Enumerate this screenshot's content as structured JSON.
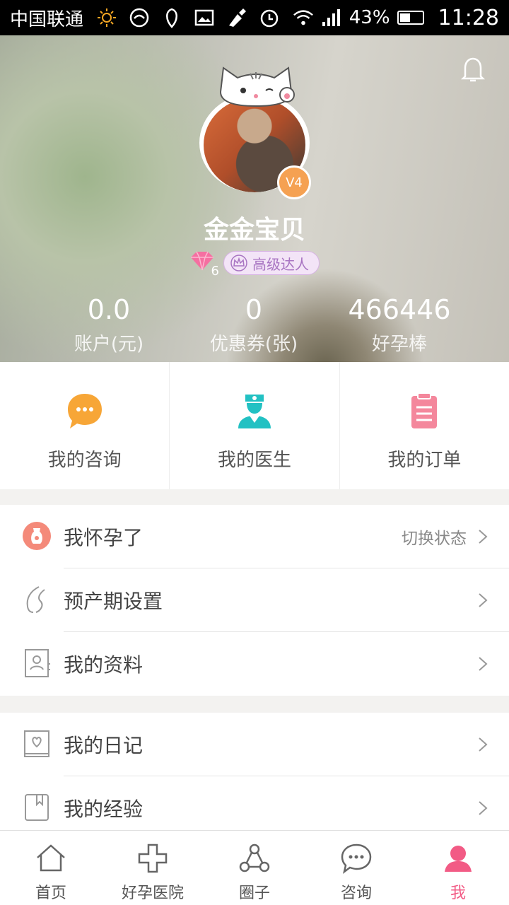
{
  "status_bar": {
    "carrier": "中国联通",
    "battery": "43%",
    "time": "11:28"
  },
  "profile": {
    "name": "金金宝贝",
    "level_badge": "V4",
    "gem_count": "6",
    "rank_label": "高级达人"
  },
  "stats": [
    {
      "value": "0.0",
      "label": "账户(元)"
    },
    {
      "value": "0",
      "label": "优惠券(张)"
    },
    {
      "value": "466446",
      "label": "好孕棒"
    }
  ],
  "quick_actions": [
    {
      "label": "我的咨询",
      "icon": "chat-bubble-icon",
      "color": "#f7a637"
    },
    {
      "label": "我的医生",
      "icon": "doctor-icon",
      "color": "#22c1c3"
    },
    {
      "label": "我的订单",
      "icon": "clipboard-icon",
      "color": "#f4879c"
    }
  ],
  "menu_group_1": [
    {
      "label": "我怀孕了",
      "right_text": "切换状态",
      "icon": "pregnant-icon"
    },
    {
      "label": "预产期设置",
      "icon": "due-date-icon"
    },
    {
      "label": "我的资料",
      "icon": "profile-card-icon"
    }
  ],
  "menu_group_2": [
    {
      "label": "我的日记",
      "icon": "diary-icon"
    },
    {
      "label": "我的经验",
      "icon": "bookmark-book-icon"
    }
  ],
  "bottom_nav": [
    {
      "label": "首页",
      "icon": "home-icon"
    },
    {
      "label": "好孕医院",
      "icon": "hospital-cross-icon"
    },
    {
      "label": "圈子",
      "icon": "circle-group-icon"
    },
    {
      "label": "咨询",
      "icon": "chat-icon"
    },
    {
      "label": "我",
      "icon": "user-icon",
      "active": true
    }
  ],
  "colors": {
    "accent": "#f25b85",
    "orange": "#f7a637",
    "teal": "#22c1c3",
    "pink": "#f4879c"
  }
}
